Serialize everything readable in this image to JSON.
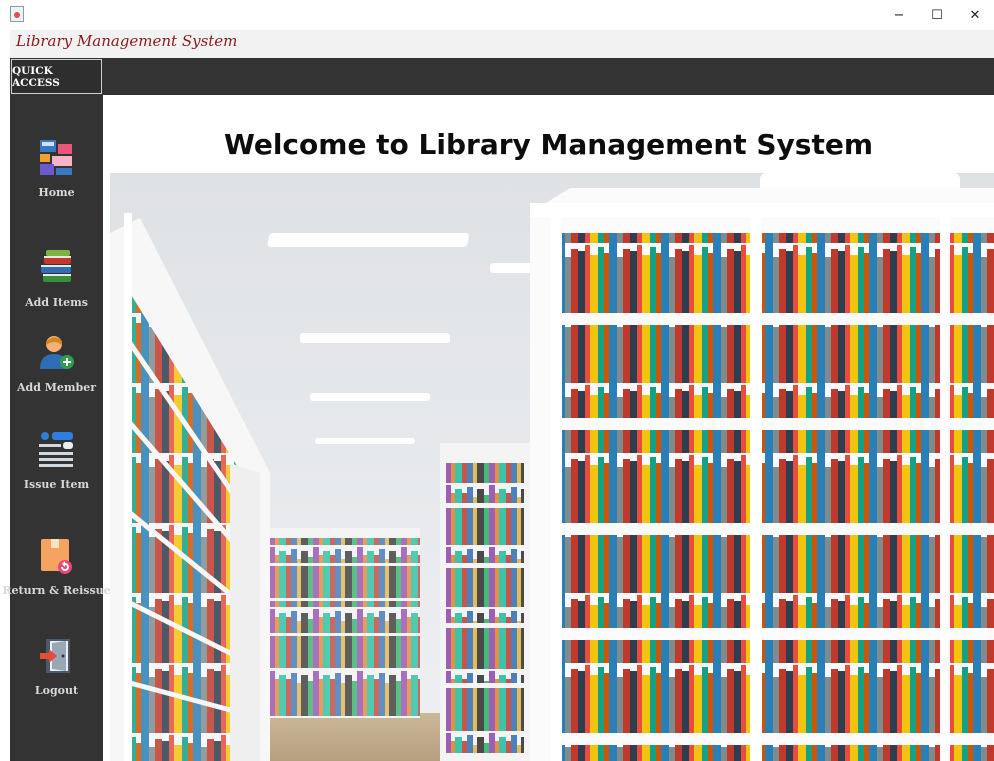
{
  "window": {
    "minimize_glyph": "−",
    "maximize_glyph": "☐",
    "close_glyph": "✕"
  },
  "app": {
    "title": "Library Management System"
  },
  "sidebar": {
    "header": "QUICK ACCESS",
    "items": [
      {
        "label": "Home",
        "icon": "home-dashboard-icon"
      },
      {
        "label": "Add Items",
        "icon": "books-stack-icon"
      },
      {
        "label": "Add Member",
        "icon": "add-user-icon"
      },
      {
        "label": "Issue Item",
        "icon": "list-toggle-icon"
      },
      {
        "label": "Return & Reissue",
        "icon": "return-box-icon"
      },
      {
        "label": "Logout",
        "icon": "logout-door-icon"
      }
    ]
  },
  "main": {
    "welcome": "Welcome to Library Management System"
  },
  "colors": {
    "sidebar_bg": "#333333",
    "title_accent": "#8b1a1a",
    "welcome_text": "#0d0d0d"
  }
}
